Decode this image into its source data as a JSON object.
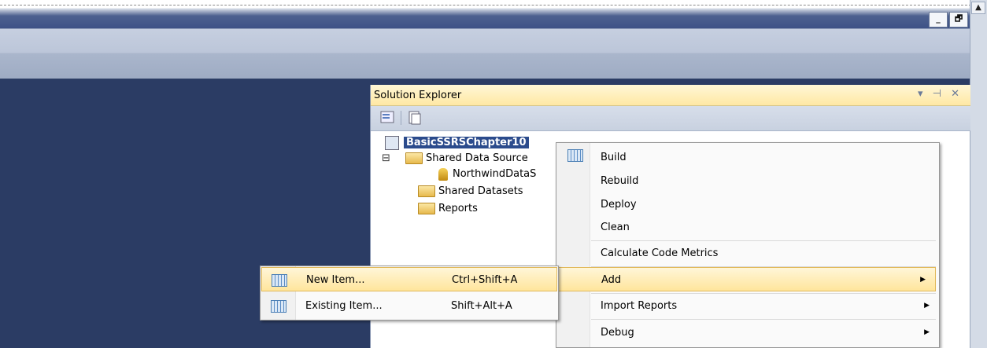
{
  "window": {
    "scroll_up_glyph": "▲",
    "buttons": [
      "_",
      "🗗"
    ]
  },
  "solution_explorer": {
    "title": "Solution Explorer",
    "controls": "▾ ⊣ ✕",
    "tree": {
      "project": "BasicSSRSChapter10",
      "shared_data_sources": "Shared Data Source",
      "data_source": "NorthwindDataS",
      "shared_datasets": "Shared Datasets",
      "reports": "Reports",
      "collapse_glyph": "⊟"
    }
  },
  "context_menu": {
    "items": {
      "build": "Build",
      "rebuild": "Rebuild",
      "deploy": "Deploy",
      "clean": "Clean",
      "calc": "Calculate Code Metrics",
      "add": "Add",
      "import": "Import Reports",
      "debug": "Debug"
    },
    "submenu_arrow": "▶"
  },
  "add_submenu": {
    "new_item": {
      "label": "New Item...",
      "shortcut": "Ctrl+Shift+A"
    },
    "existing_item": {
      "label": "Existing Item...",
      "shortcut": "Shift+Alt+A"
    }
  },
  "colors": {
    "highlight": "#ffe59c",
    "selection": "#2b4b8c",
    "background": "#2b3c64"
  }
}
